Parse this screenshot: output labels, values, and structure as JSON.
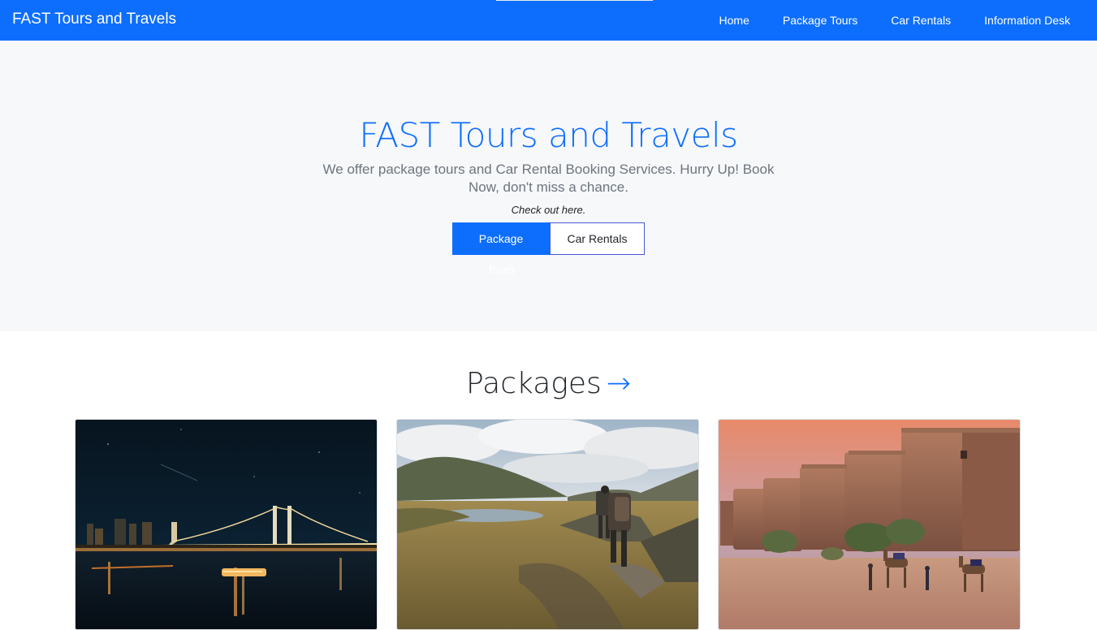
{
  "navbar": {
    "brand": "FAST Tours and Travels",
    "links": [
      "Home",
      "Package Tours",
      "Car Rentals",
      "Information Desk"
    ]
  },
  "hero": {
    "title": "FAST Tours and Travels",
    "subtitle": "We offer package tours and Car Rental Booking Services. Hurry Up! Book Now, don't miss a chance.",
    "check": "Check out here.",
    "buttons": {
      "primary": "Package Tours",
      "secondary": "Car Rentals"
    }
  },
  "packages": {
    "heading": "Packages",
    "arrow": "→"
  },
  "colors": {
    "accent": "#0d6efd",
    "hero_bg": "#f7f8fa"
  }
}
